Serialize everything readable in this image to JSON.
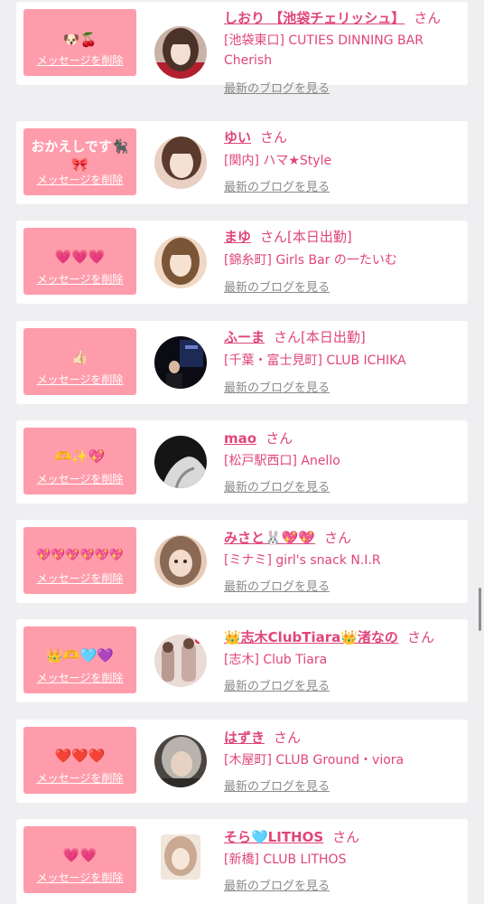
{
  "entries": [
    {
      "message": "🐶🍒",
      "delete_label": "メッセージを削除",
      "name": "しおり 【池袋チェリッシュ】",
      "san": "さん",
      "status": "",
      "shop": "[池袋東口] CUTIES DINNING BAR Cherish",
      "blog_label": "最新のブログを見る",
      "avatar_colors": [
        "#c9b3a8",
        "#2b2b33"
      ]
    },
    {
      "message": "おかえしです🐈‍⬛🎀",
      "delete_label": "メッセージを削除",
      "name": "ゆい",
      "san": "さん",
      "status": "",
      "shop": "[関内] ハマ★Style",
      "blog_label": "最新のブログを見る",
      "avatar_colors": [
        "#e9d0c2",
        "#5a3a2c"
      ]
    },
    {
      "message": "💗💗💗",
      "delete_label": "メッセージを削除",
      "name": "まゆ",
      "san": "さん",
      "status": "[本日出勤]",
      "shop": "[錦糸町] Girls Bar の一たいむ",
      "blog_label": "最新のブログを見る",
      "avatar_colors": [
        "#f0d8c4",
        "#7a5536"
      ]
    },
    {
      "message": "👍🏻",
      "delete_label": "メッセージを削除",
      "name": "ふーま",
      "san": "さん",
      "status": "[本日出勤]",
      "shop": "[千葉・富士見町] CLUB ICHIKA",
      "blog_label": "最新のブログを見る",
      "avatar_colors": [
        "#1d2a55",
        "#0b0b14"
      ]
    },
    {
      "message": "🫶✨💖",
      "delete_label": "メッセージを削除",
      "name": "mao",
      "san": "さん",
      "status": "",
      "shop": "[松戸駅西口] Anello",
      "blog_label": "最新のブログを見る",
      "avatar_colors": [
        "#d9d9d9",
        "#151515"
      ]
    },
    {
      "message": "💖💖💖💖💖💖",
      "delete_label": "メッセージを削除",
      "name": "みさと🐰💖💖",
      "san": "さん",
      "status": "",
      "shop": "[ミナミ] girl's snack N.I.R",
      "blog_label": "最新のブログを見る",
      "avatar_colors": [
        "#e7cbb8",
        "#8b6a55"
      ]
    },
    {
      "message": "👑🫶🩵💜",
      "delete_label": "メッセージを削除",
      "name": "👑志木ClubTiara👑渚なの",
      "san": "さん",
      "status": "",
      "shop": "[志木] Club Tiara",
      "blog_label": "最新のブログを見る",
      "avatar_colors": [
        "#e9dcd6",
        "#b89a92"
      ]
    },
    {
      "message": "❤️❤️❤️",
      "delete_label": "メッセージを削除",
      "name": "はずき",
      "san": "さん",
      "status": "",
      "shop": "[木屋町] CLUB Ground・viora",
      "blog_label": "最新のブログを見る",
      "avatar_colors": [
        "#b9b3ad",
        "#4a4540"
      ]
    },
    {
      "message": "💗💗",
      "delete_label": "メッセージを削除",
      "name": "そら🩵LITHOS",
      "san": "さん",
      "status": "",
      "shop": "[新橋] CLUB LITHOS",
      "blog_label": "最新のブログを見る",
      "avatar_colors": [
        "#f1e6dc",
        "#c9a992"
      ]
    }
  ]
}
